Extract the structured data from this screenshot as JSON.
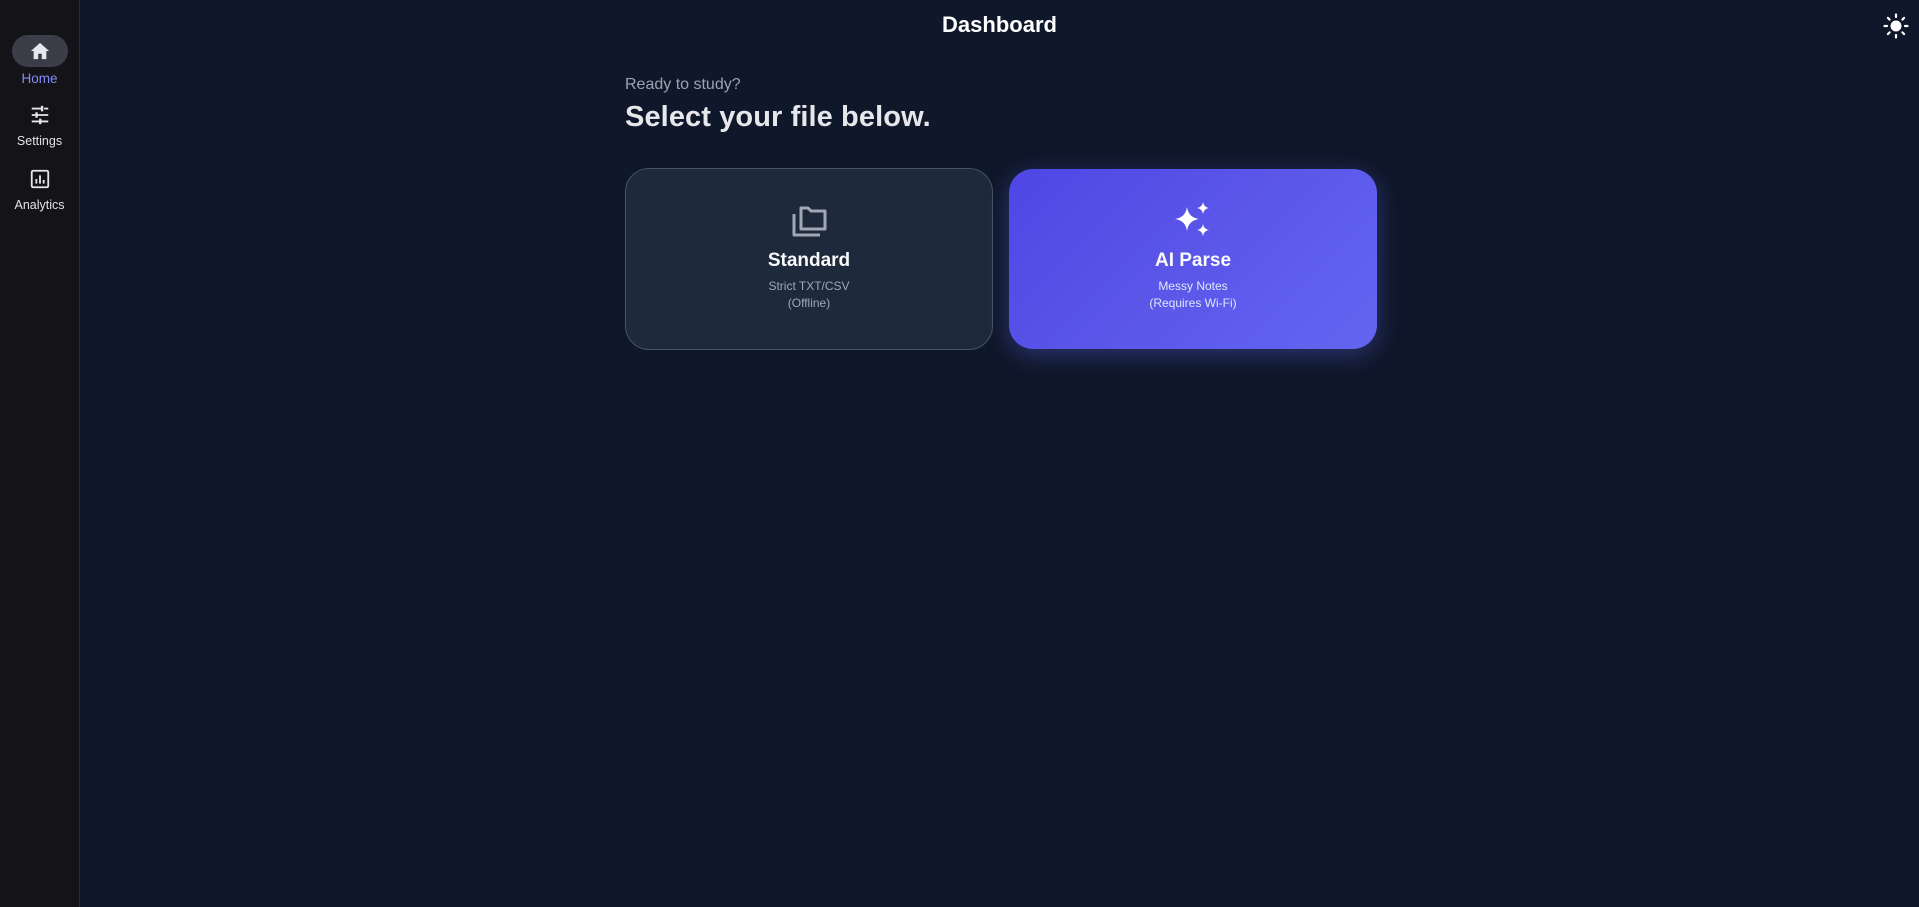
{
  "sidebar": {
    "items": [
      {
        "label": "Home",
        "icon": "home-icon",
        "active": true
      },
      {
        "label": "Settings",
        "icon": "sliders-icon",
        "active": false
      },
      {
        "label": "Analytics",
        "icon": "analytics-icon",
        "active": false
      }
    ]
  },
  "header": {
    "title": "Dashboard",
    "theme_toggle_icon": "sun-icon"
  },
  "main": {
    "subheading": "Ready to study?",
    "heading": "Select your file below.",
    "cards": [
      {
        "title": "Standard",
        "line1": "Strict TXT/CSV",
        "line2": "(Offline)",
        "icon": "folder-icon"
      },
      {
        "title": "AI Parse",
        "line1": "Messy Notes",
        "line2": "(Requires Wi-Fi)",
        "icon": "sparkles-icon"
      }
    ]
  },
  "colors": {
    "background": "#0f172a",
    "sidebar": "#141317",
    "accent": "#6366f1",
    "active_label": "#818cf8",
    "card_standard": "#1e293b"
  }
}
